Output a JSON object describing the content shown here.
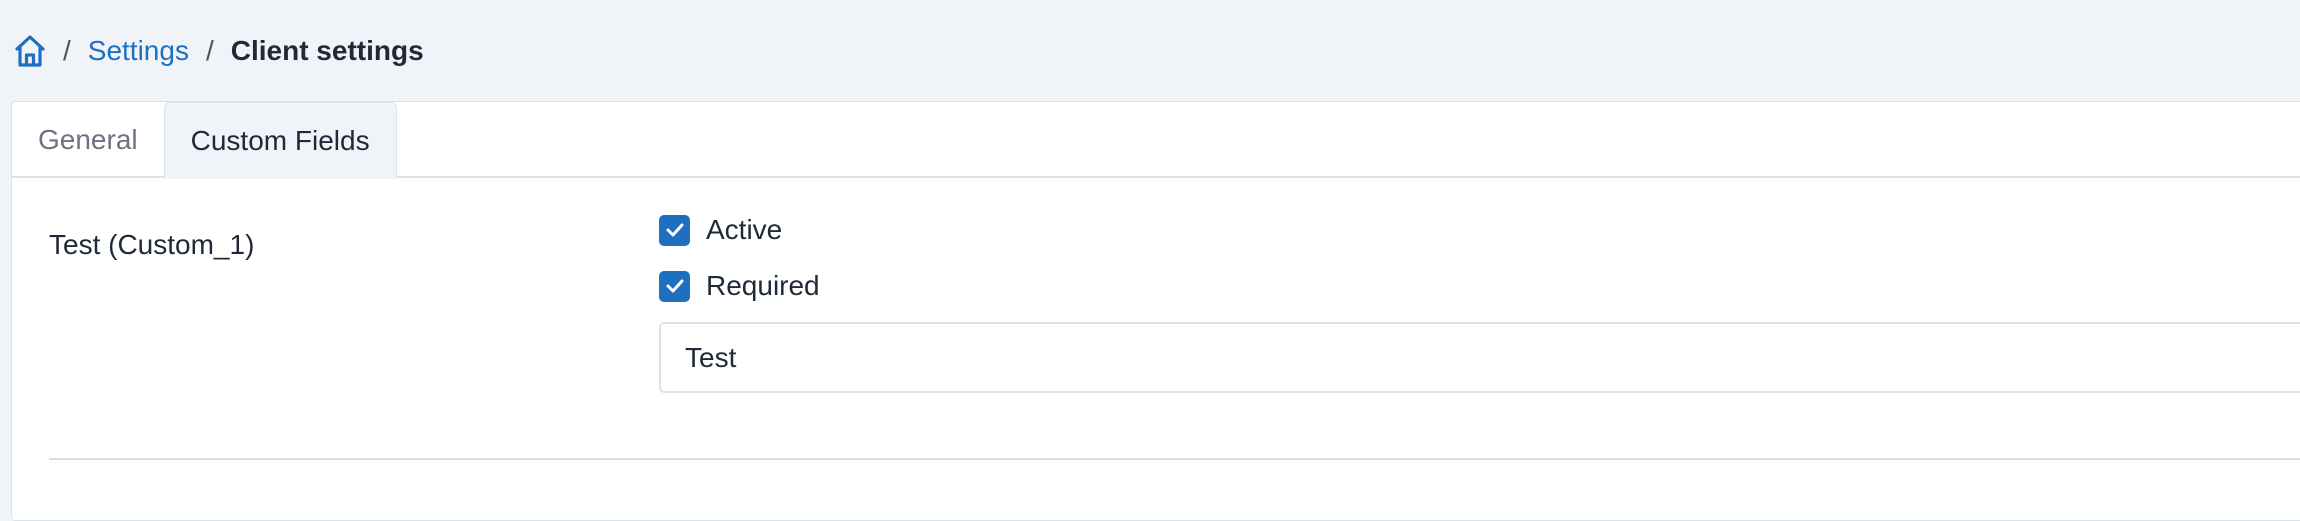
{
  "breadcrumb": {
    "home_icon": "home-icon",
    "separator": "/",
    "settings_label": "Settings",
    "current_label": "Client settings"
  },
  "tabs": [
    {
      "label": "General",
      "active": false
    },
    {
      "label": "Custom Fields",
      "active": true
    }
  ],
  "custom_field": {
    "label": "Test (Custom_1)",
    "active_label": "Active",
    "active_checked": true,
    "required_label": "Required",
    "required_checked": true,
    "value": "Test"
  },
  "colors": {
    "accent": "#1f6fc1",
    "page_background": "#f0f3f8",
    "border": "#dde2ea"
  }
}
